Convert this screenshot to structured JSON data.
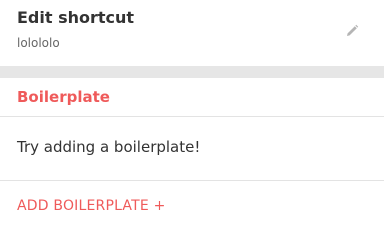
{
  "header": {
    "title": "Edit shortcut",
    "subtitle": "lolololo",
    "edit_icon": "pencil-icon"
  },
  "section": {
    "title": "Boilerplate",
    "empty_message": "Try adding a boilerplate!",
    "add_label": "ADD BOILERPLATE +"
  },
  "colors": {
    "accent": "#ef5a5a",
    "divider_band": "#e6e6e6",
    "text": "#333333",
    "subtext": "#666666"
  }
}
